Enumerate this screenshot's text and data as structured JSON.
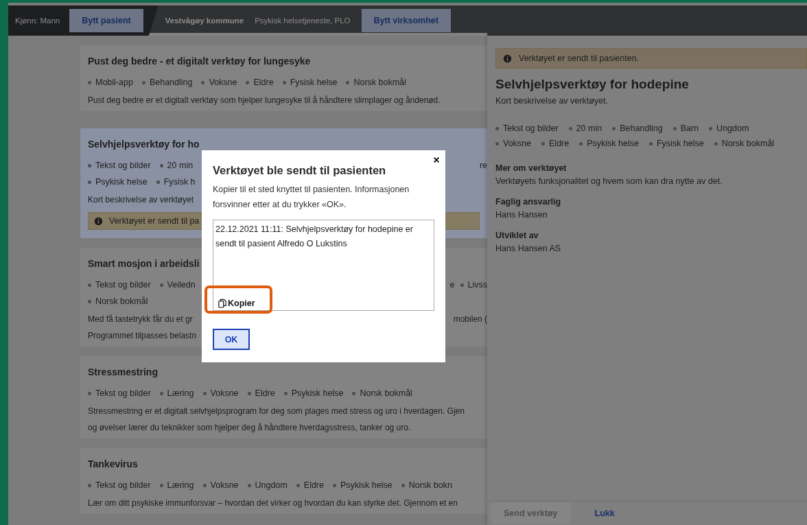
{
  "header": {
    "gender": "Kjønn: Mann",
    "change_patient": "Bytt pasient",
    "municipality": "Vestvågøy kommune",
    "unit": "Psykisk helsetjeneste, PLO",
    "change_unit": "Bytt virksomhet"
  },
  "tools": [
    {
      "title": "Pust deg bedre - et digitalt verktøy for lungesyke",
      "selected": false,
      "tag_rows": [
        {
          "tags": [
            "Mobil-app",
            "Behandling",
            "Voksne",
            "Eldre",
            "Fysisk helse",
            "Norsk bokmål"
          ]
        }
      ],
      "lines": [
        {
          "text": "Pust deg bedre er et digitalt verktøy som hjelper lungesyke til å håndtere slimplager og åndenød."
        }
      ]
    },
    {
      "title": "Selvhjelpsverktøy for ho",
      "selected": true,
      "tag_rows": [
        {
          "tags": [
            "Tekst og bilder",
            "20 min"
          ],
          "tail": [
            {
              "text": "re",
              "bullet": false
            }
          ]
        },
        {
          "tags": [
            "Psykisk helse",
            "Fysisk h"
          ]
        }
      ],
      "lines": [
        {
          "text": "Kort beskrivelse av verktøyet"
        }
      ],
      "notice": "Verktøyet er sendt til pa"
    },
    {
      "title": "Smart mosjon i arbeidsli",
      "selected": false,
      "tag_rows": [
        {
          "tags": [
            "Tekst og bilder",
            "Veiledn"
          ],
          "tail": [
            {
              "text": "e",
              "bullet": false
            },
            {
              "text": "Livss",
              "bullet": true
            }
          ]
        },
        {
          "tags": [
            "Norsk bokmål"
          ]
        }
      ],
      "lines": [
        {
          "text": "Med få tastetrykk får du et gr",
          "tail": "mobilen ("
        },
        {
          "text": "Programmet tilpasses belastn"
        }
      ]
    },
    {
      "title": "Stressmestring",
      "selected": false,
      "tag_rows": [
        {
          "tags": [
            "Tekst og bilder",
            "Læring",
            "Voksne",
            "Eldre",
            "Psykisk helse",
            "Norsk bokmål"
          ]
        }
      ],
      "lines": [
        {
          "text": "Stressmestring er et digitalt selvhjelpsprogram for deg som plages med stress og uro i hverdagen. Gjen"
        },
        {
          "text": "og øvelser lærer du teknikker som hjelper deg å håndtere hverdagsstress, tanker og uro."
        }
      ]
    },
    {
      "title": "Tankevirus",
      "selected": false,
      "tag_rows": [
        {
          "tags": [
            "Tekst og bilder",
            "Læring",
            "Voksne",
            "Ungdom",
            "Eldre",
            "Psykisk helse",
            "Norsk bokn"
          ]
        }
      ],
      "lines": [
        {
          "text": "Lær om ditt psykiske immunforsvar – hvordan det virker og hvordan du kan styrke det. Gjennom et en"
        }
      ]
    }
  ],
  "detail_panel": {
    "notice": "Verktøyet er sendt til pasienten.",
    "title": "Selvhjelpsverktøy for hodepine",
    "summary": "Kort beskrivelse av verktøyet.",
    "tags": [
      "Tekst og bilder",
      "20 min",
      "Behandling",
      "Barn",
      "Ungdom",
      "Voksne",
      "Eldre",
      "Psykisk helse",
      "Fysisk helse",
      "Norsk bokmål"
    ],
    "sections": [
      {
        "heading": "Mer om verktøyet",
        "text": "Verktøyets funksjonalitet og hvem som kan dra nytte av det."
      },
      {
        "heading": "Faglig ansvarlig",
        "text": "Hans Hansen"
      },
      {
        "heading": "Utviklet av",
        "text": "Hans Hansen AS"
      }
    ],
    "send_button": {
      "label": "Send verktøy",
      "disabled": true
    },
    "close_link": "Lukk"
  },
  "dialog": {
    "title": "Verktøyet ble sendt til pasienten",
    "text": "Kopier til et sted knyttet til pasienten. Informasjonen forsvinner etter at du trykker «OK».",
    "message": "22.12.2021 11:11: Selvhjelpsverktøy for hodepine er sendt til pasient Alfredo O Lukstins",
    "copy_button": "Kopier",
    "ok_button": "OK"
  }
}
